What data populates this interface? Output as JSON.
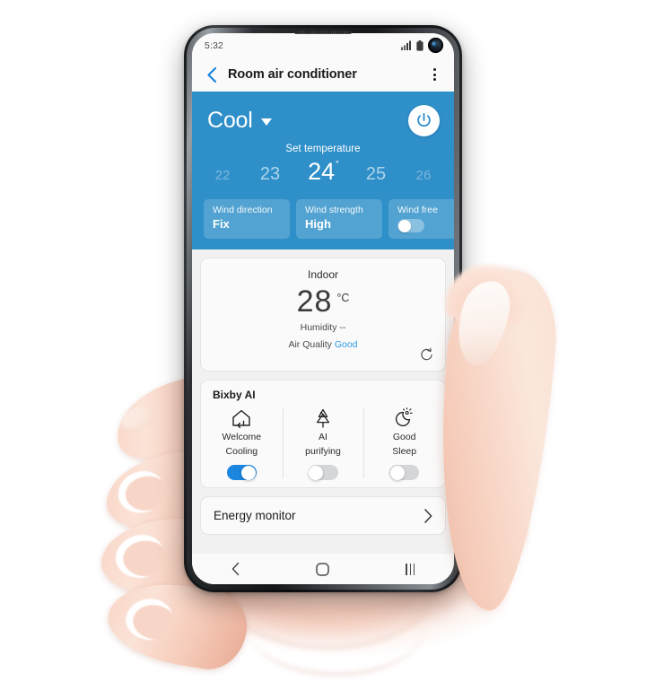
{
  "scene": {
    "description": "Samsung smartphone held in a hand showing SmartThings room air conditioner control screen"
  },
  "phone": {
    "status_bar": {
      "time": "5:32",
      "icons": [
        "signal-bars-icon",
        "battery-icon",
        "front-camera-punch-hole"
      ]
    },
    "app_bar": {
      "back_icon": "chevron-left-icon",
      "title": "Room air conditioner",
      "more_icon": "kebab-menu-icon"
    },
    "control_panel": {
      "mode": "Cool",
      "mode_caret_icon": "caret-down-icon",
      "power_icon": "power-icon",
      "set_temperature_label": "Set temperature",
      "temperatures": [
        {
          "value": "22",
          "state": "far"
        },
        {
          "value": "23",
          "state": "near"
        },
        {
          "value": "24",
          "state": "selected",
          "degree": "˚"
        },
        {
          "value": "25",
          "state": "near"
        },
        {
          "value": "26",
          "state": "far"
        }
      ],
      "selected_temperature": "24",
      "chips": [
        {
          "label": "Wind direction",
          "value": "Fix",
          "type": "value"
        },
        {
          "label": "Wind strength",
          "value": "High",
          "type": "value"
        },
        {
          "label": "Wind free",
          "value": "off",
          "type": "toggle"
        }
      ],
      "accent_color": "#2e8fc9"
    },
    "indoor_card": {
      "title": "Indoor",
      "temperature": "28",
      "unit": "°C",
      "humidity_label": "Humidity",
      "humidity_value": "--",
      "air_quality_label": "Air Quality",
      "air_quality_value": "Good",
      "air_quality_color": "#2e9ae0",
      "refresh_icon": "refresh-icon"
    },
    "bixby_card": {
      "title": "Bixby AI",
      "items": [
        {
          "icon": "welcome-cooling-home-icon",
          "label_line1": "Welcome",
          "label_line2": "Cooling",
          "toggle": "on"
        },
        {
          "icon": "ai-purifying-tree-icon",
          "label_line1": "AI",
          "label_line2": "purifying",
          "toggle": "off"
        },
        {
          "icon": "good-sleep-moon-icon",
          "label_line1": "Good",
          "label_line2": "Sleep",
          "toggle": "off"
        }
      ],
      "toggle_on_color": "#1a86e0",
      "toggle_off_color": "#d4d6d9"
    },
    "energy_card": {
      "label": "Energy monitor",
      "chevron_icon": "chevron-right-icon"
    },
    "nav_bar": {
      "back_icon": "nav-back-icon",
      "home_icon": "nav-home-icon",
      "recents_icon": "nav-recents-icon"
    }
  }
}
